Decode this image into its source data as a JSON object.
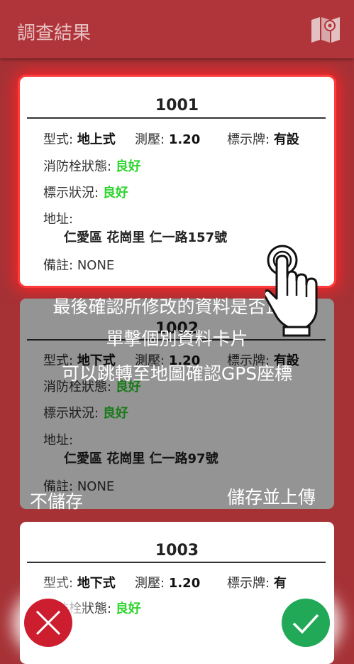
{
  "appbar": {
    "title": "調查結果",
    "map_icon": "map-icon"
  },
  "labels": {
    "type": "型式:",
    "pressure": "測壓:",
    "sign": "標示牌:",
    "hydrant_status": "消防栓狀態:",
    "sign_status": "標示狀況:",
    "address": "地址:",
    "remark": "備註:"
  },
  "cards": [
    {
      "id": "1001",
      "type": "地上式",
      "pressure": "1.20",
      "sign": "有設",
      "hydrant_status": "良好",
      "sign_status": "良好",
      "address": "仁愛區 花崗里 仁一路157號",
      "remark": "NONE"
    },
    {
      "id": "1002",
      "type": "地下式",
      "pressure": "1.20",
      "sign": "有設",
      "hydrant_status": "良好",
      "sign_status": "良好",
      "address": "仁愛區 花崗里 仁一路97號",
      "remark": "NONE"
    },
    {
      "id": "1003",
      "type": "地下式",
      "pressure": "1.20",
      "sign": "有",
      "hydrant_status": "良好"
    }
  ],
  "overlay": {
    "line1": "最後確認所修改的資料是否正確",
    "line2": "單擊個別資料卡片",
    "line3": "可以跳轉至地圖確認GPS座標",
    "discard_label": "不儲存",
    "save_label": "儲存並上傳"
  },
  "colors": {
    "appbar": "#b0353a",
    "good": "#2ed52e",
    "discard": "#cc1e2f",
    "save": "#21a958"
  }
}
